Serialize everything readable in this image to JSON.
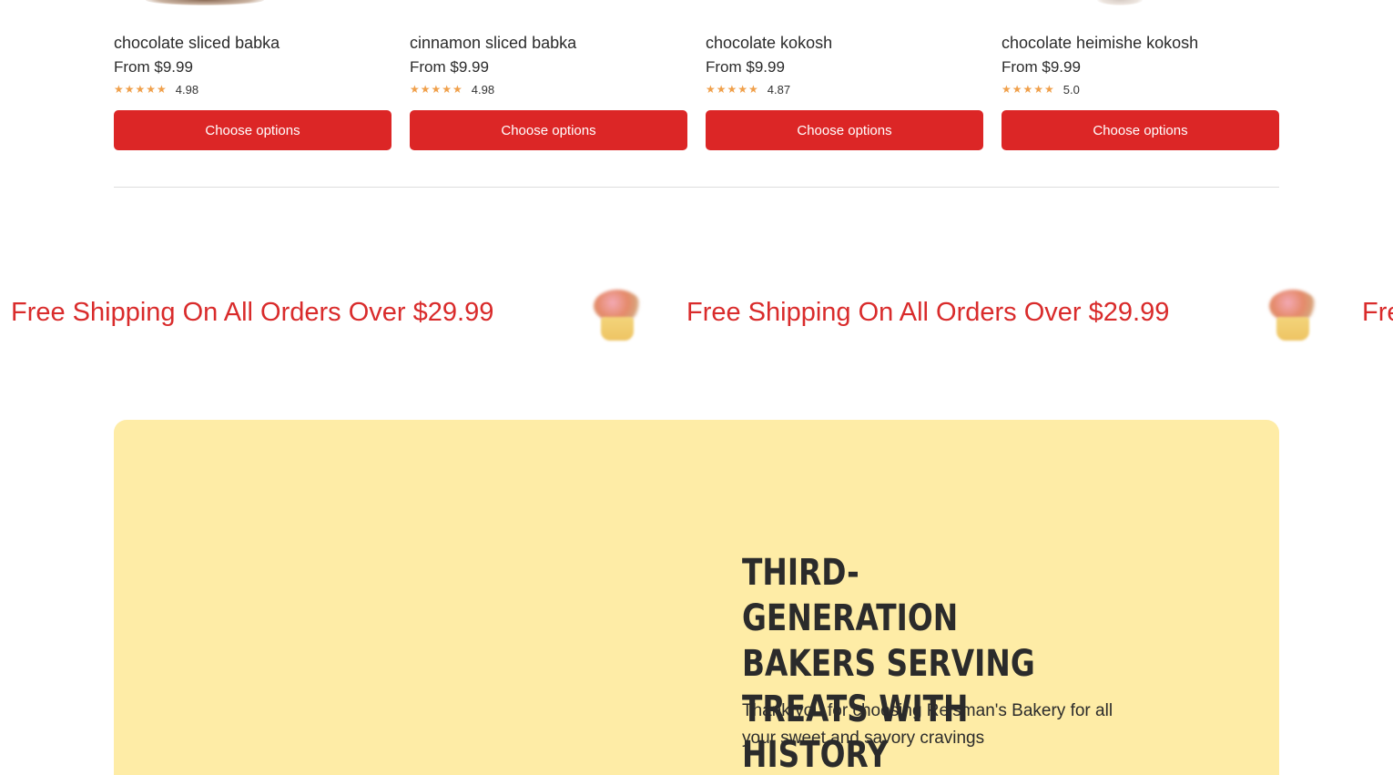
{
  "products": [
    {
      "title": "chocolate sliced babka",
      "price": "From $9.99",
      "stars": "★★★★★",
      "rating": "4.98",
      "button_label": "Choose options"
    },
    {
      "title": "cinnamon sliced babka",
      "price": "From $9.99",
      "stars": "★★★★★",
      "rating": "4.98",
      "button_label": "Choose options"
    },
    {
      "title": "chocolate kokosh",
      "price": "From $9.99",
      "stars": "★★★★★",
      "rating": "4.87",
      "button_label": "Choose options"
    },
    {
      "title": "chocolate heimishe kokosh",
      "price": "From $9.99",
      "stars": "★★★★★",
      "rating": "5.0",
      "button_label": "Choose options"
    }
  ],
  "marquee": {
    "text": "Free Shipping On All Orders Over $29.99",
    "text_partial": "Fre",
    "icon": "cupcake-icon"
  },
  "story": {
    "heading": "Third-Generation Bakers Serving Treats With History",
    "body": "Thank you for choosing Reisman's Bakery for all your sweet and savory cravings"
  },
  "colors": {
    "accent_red": "#dc2626",
    "marquee_red": "#d92b2b",
    "star_orange": "#f0a04b",
    "story_bg": "#feeca6"
  }
}
